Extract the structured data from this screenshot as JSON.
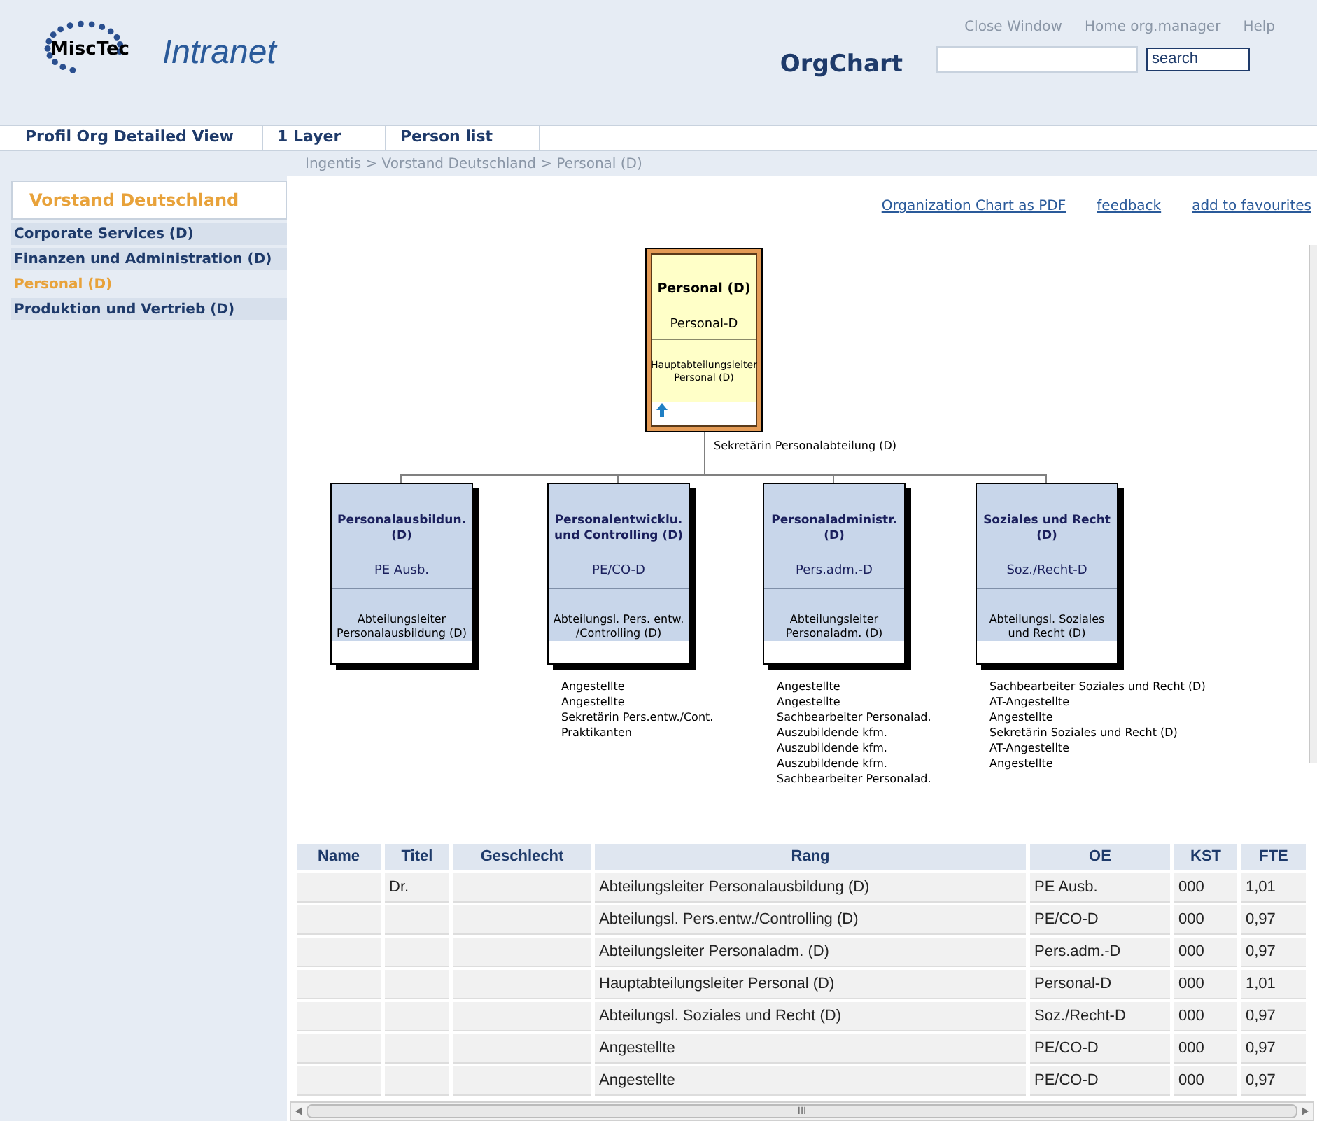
{
  "header": {
    "logo_text": "MiscTec",
    "site_name": "Intranet",
    "page_title": "OrgChart",
    "links": [
      "Close Window",
      "Home org.manager",
      "Help"
    ],
    "search_button": "search"
  },
  "tabs": [
    {
      "label": "Profil Org Detailed View",
      "selected": false
    },
    {
      "label": "1 Layer",
      "selected": false
    },
    {
      "label": "Person list",
      "selected": false
    }
  ],
  "breadcrumb": "Ingentis > Vorstand Deutschland > Personal (D)",
  "sidebar": {
    "heading": "Vorstand Deutschland",
    "items": [
      {
        "label": "Corporate Services (D)",
        "selected": false
      },
      {
        "label": "Finanzen und Administration (D)",
        "selected": false
      },
      {
        "label": "Personal (D)",
        "selected": true
      },
      {
        "label": "Produktion und Vertrieb (D)",
        "selected": false
      }
    ]
  },
  "actions": [
    "Organization Chart as PDF",
    "feedback",
    "add to favourites"
  ],
  "org_chart": {
    "root": {
      "name": "Personal (D)",
      "code": "Personal-D",
      "role": "Hauptabteilungsleiter Personal (D)",
      "assistant": "Sekretärin Personalabteilung (D)"
    },
    "children": [
      {
        "name": "Personalausbildun. (D)",
        "code": "PE Ausb.",
        "role": "Abteilungsleiter Personalausbildung (D)"
      },
      {
        "name": "Personalentwicklu. und Controlling (D)",
        "code": "PE/CO-D",
        "role": "Abteilungsl. Pers. entw. /Controlling (D)",
        "staff": [
          "Angestellte",
          "Angestellte",
          "Sekretärin Pers.entw./Cont.",
          "Praktikanten"
        ]
      },
      {
        "name": "Personaladministr. (D)",
        "code": "Pers.adm.-D",
        "role": "Abteilungsleiter Personaladm. (D)",
        "staff": [
          "Angestellte",
          "Angestellte",
          "Sachbearbeiter Personalad.",
          "Auszubildende kfm.",
          "Auszubildende kfm.",
          "Auszubildende kfm.",
          "Sachbearbeiter Personalad."
        ]
      },
      {
        "name": "Soziales und Recht (D)",
        "code": "Soz./Recht-D",
        "role": "Abteilungsl. Soziales und Recht (D)",
        "staff": [
          "Sachbearbeiter Soziales und Recht (D)",
          "AT-Angestellte",
          "Angestellte",
          "Sekretärin Soziales und Recht (D)",
          "AT-Angestellte",
          "Angestellte"
        ]
      }
    ]
  },
  "table": {
    "columns": [
      "Name",
      "Titel",
      "Geschlecht",
      "Rang",
      "OE",
      "KST",
      "FTE"
    ],
    "rows": [
      [
        "",
        "Dr.",
        "",
        "Abteilungsleiter Personalausbildung (D)",
        "PE Ausb.",
        "000",
        "1,01"
      ],
      [
        "",
        "",
        "",
        "Abteilungsl. Pers.entw./Controlling (D)",
        "PE/CO-D",
        "000",
        "0,97"
      ],
      [
        "",
        "",
        "",
        "Abteilungsleiter Personaladm. (D)",
        "Pers.adm.-D",
        "000",
        "0,97"
      ],
      [
        "",
        "",
        "",
        "Hauptabteilungsleiter Personal (D)",
        "Personal-D",
        "000",
        "1,01"
      ],
      [
        "",
        "",
        "",
        "Abteilungsl. Soziales und Recht (D)",
        "Soz./Recht-D",
        "000",
        "0,97"
      ],
      [
        "",
        "",
        "",
        "Angestellte",
        "PE/CO-D",
        "000",
        "0,97"
      ],
      [
        "",
        "",
        "",
        "Angestellte",
        "PE/CO-D",
        "000",
        "0,97"
      ]
    ]
  },
  "scrollbar_grip": "III"
}
